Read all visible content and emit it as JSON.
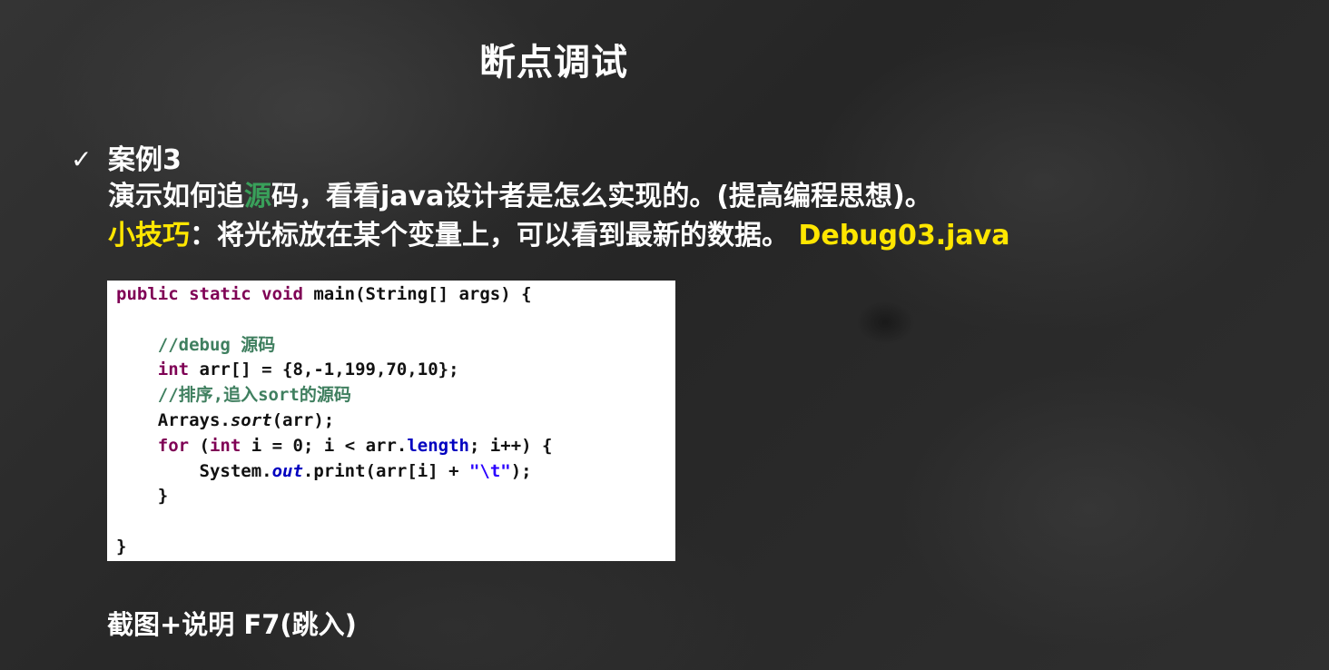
{
  "slide": {
    "title": "断点调试",
    "bullet_icon": "checkmark-icon",
    "case_label": "案例3",
    "desc_a": "演示如何追",
    "desc_cursor_char": "源",
    "desc_b": "码，看看java设计者是怎么实现的。(提高编程思想)。",
    "tip_label": "小技巧",
    "tip_text": "：将光标放在某个变量上，可以看到最新的数据。 ",
    "tip_file": "Debug03.java",
    "footer": "截图+说明  F7(跳入)"
  },
  "code": {
    "l1": {
      "kw": "public static void",
      "rest": " main(String[] args) {"
    },
    "l3": {
      "comment": "//debug 源码"
    },
    "l4": {
      "kw": "int",
      "rest": " arr[] = {8,-1,199,70,10};"
    },
    "l5": {
      "comment": "//排序,追入sort的源码"
    },
    "l6": {
      "a": "Arrays.",
      "method": "sort",
      "b": "(arr);"
    },
    "l7": {
      "kw1": "for",
      "a": " (",
      "kw2": "int",
      "b": " i = 0; i < arr.",
      "field": "length",
      "c": "; i++) {"
    },
    "l8": {
      "a": "System.",
      "field": "out",
      "b": ".print(arr[i] + ",
      "str": "\"\\t\"",
      "c": ");"
    },
    "l9": {
      "text": "}"
    },
    "l11": {
      "text": "}"
    }
  },
  "colors": {
    "background": "#2c2c2c",
    "highlight_yellow": "#ffe600",
    "code_keyword": "#7f0055",
    "code_comment": "#3f7f5f",
    "code_field": "#0000c0",
    "code_string": "#2a00ff"
  }
}
